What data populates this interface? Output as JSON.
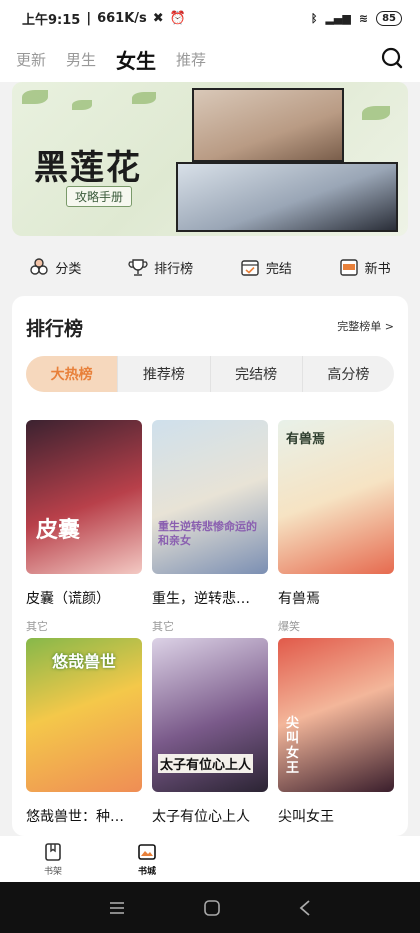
{
  "status": {
    "time": "上午9:15",
    "speed": "661K/s",
    "battery": "85"
  },
  "nav": {
    "tabs": [
      "更新",
      "男生",
      "女生",
      "推荐"
    ],
    "active": 2
  },
  "banner": {
    "title": "黑莲花",
    "subtitle": "攻略手册"
  },
  "quick": [
    {
      "label": "分类",
      "icon": "category-icon"
    },
    {
      "label": "排行榜",
      "icon": "trophy-icon"
    },
    {
      "label": "完结",
      "icon": "calendar-check-icon"
    },
    {
      "label": "新书",
      "icon": "new-book-icon"
    }
  ],
  "ranking": {
    "title": "排行榜",
    "more": "完整榜单 >",
    "segments": [
      "大热榜",
      "推荐榜",
      "完结榜",
      "高分榜"
    ],
    "books": [
      {
        "name": "皮囊（谎颜）",
        "tag": "其它",
        "cover_text": "皮囊",
        "colors": [
          "#3b2230",
          "#b8404a",
          "#f3c9c3"
        ]
      },
      {
        "name": "重生，逆转悲…",
        "tag": "其它",
        "cover_text": "重生逆转悲惨命运的和亲女",
        "colors": [
          "#cfe0ec",
          "#e8e3d6",
          "#7b8fb3"
        ]
      },
      {
        "name": "有兽焉",
        "tag": "爆笑",
        "cover_text": "有兽焉",
        "colors": [
          "#e8f1e9",
          "#f6e3c3",
          "#e66a4f"
        ]
      },
      {
        "name": "悠哉兽世：种…",
        "tag": "",
        "cover_text": "悠哉兽世",
        "colors": [
          "#f4c84a",
          "#ef8d55",
          "#86b84a"
        ]
      },
      {
        "name": "太子有位心上人",
        "tag": "",
        "cover_text": "太子有位心上人",
        "colors": [
          "#dcd2e6",
          "#7a5a8a",
          "#2b2433"
        ]
      },
      {
        "name": "尖叫女王",
        "tag": "",
        "cover_text": "尖叫女王",
        "colors": [
          "#e15a4a",
          "#f3b69a",
          "#3a1e2c"
        ]
      }
    ]
  },
  "bottomnav": [
    {
      "label": "书架",
      "icon": "bookshelf-icon"
    },
    {
      "label": "书城",
      "icon": "bookstore-icon"
    }
  ],
  "accent": "#e8803a"
}
